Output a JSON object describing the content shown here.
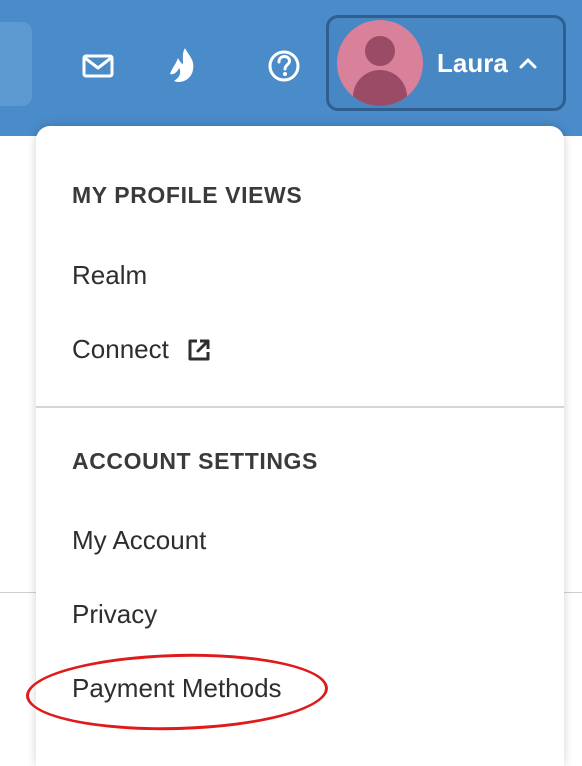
{
  "header": {
    "icons": {
      "mail": "mail-icon",
      "flame": "flame-icon",
      "help": "help-icon"
    },
    "user": {
      "name": "Laura",
      "avatar_color": "#d9809a",
      "caret": "chevron-up-icon"
    }
  },
  "dropdown": {
    "sections": [
      {
        "title": "MY PROFILE VIEWS",
        "items": [
          "Realm",
          "Connect"
        ]
      },
      {
        "title": "ACCOUNT SETTINGS",
        "items": [
          "My Account",
          "Privacy",
          "Payment Methods"
        ]
      }
    ]
  },
  "colors": {
    "topbar": "#4a8bc9",
    "highlight": "#e01a1a"
  }
}
